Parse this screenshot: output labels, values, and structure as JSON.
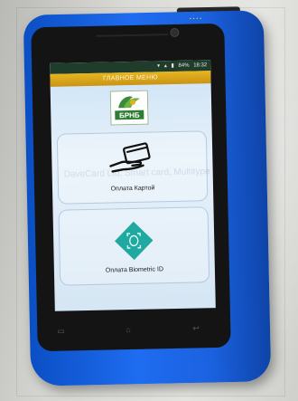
{
  "screen": {
    "header_title": "ГЛАВНОЕ МЕНЮ",
    "status": {
      "battery": "84%",
      "time": "18:32"
    },
    "logo_text": "БРНБ",
    "watermark": "DaveCard Ltd, Smart card, Multitype",
    "buttons": [
      {
        "label": "Оплата Картой",
        "icon": "card-hand-icon"
      },
      {
        "label": "Оплата Biometric ID",
        "icon": "biometric-face-icon"
      }
    ],
    "nav": [
      {
        "icon": "menu-icon"
      },
      {
        "icon": "home-icon"
      },
      {
        "icon": "back-icon"
      }
    ]
  },
  "colors": {
    "device_blue": "#1e6cf0",
    "header_gold": "#e8b520",
    "status_bar": "#1f3d2a",
    "screen_bg": "#e6f1fa",
    "biometric_teal": "#1fa9a0"
  }
}
